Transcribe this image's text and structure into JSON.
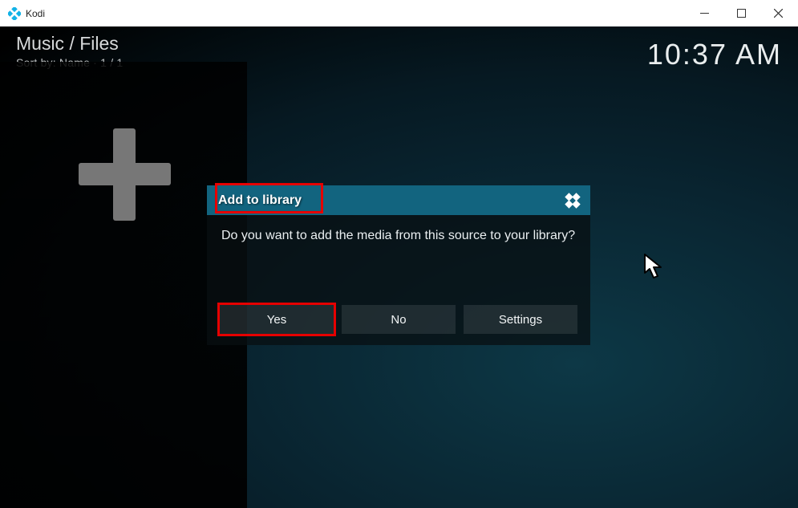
{
  "window": {
    "app_title": "Kodi"
  },
  "header": {
    "breadcrumb": "Music / Files",
    "sort_line": "Sort by: Name  · 1 / 1",
    "clock": "10:37 AM"
  },
  "dialog": {
    "title": "Add to library",
    "message": "Do you want to add the media from this source to your library?",
    "buttons": {
      "yes": "Yes",
      "no": "No",
      "settings": "Settings"
    }
  }
}
